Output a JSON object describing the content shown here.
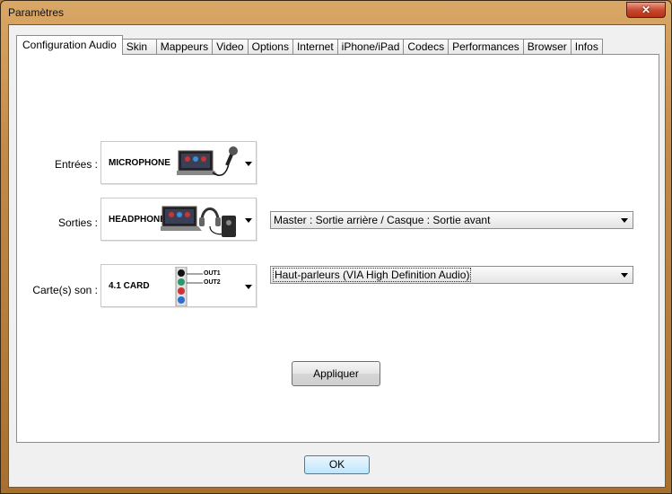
{
  "window": {
    "title": "Paramètres",
    "close_label": "✕"
  },
  "tabs": [
    "Configuration Audio",
    "Skin",
    "Mappeurs",
    "Video",
    "Options",
    "Internet",
    "iPhone/iPad",
    "Codecs",
    "Performances",
    "Browser",
    "Infos"
  ],
  "audio": {
    "inputs": {
      "label": "Entrées :",
      "device": "MICROPHONE"
    },
    "outputs": {
      "label": "Sorties :",
      "device": "HEADPHONES",
      "mode": "Master : Sortie arrière / Casque : Sortie avant"
    },
    "soundcard": {
      "label": "Carte(s) son :",
      "device": "4.1 CARD",
      "out1": "OUT1",
      "out2": "OUT2",
      "selected": "Haut-parleurs (VIA High Definition Audio)"
    }
  },
  "buttons": {
    "apply": "Appliquer",
    "ok": "OK"
  }
}
